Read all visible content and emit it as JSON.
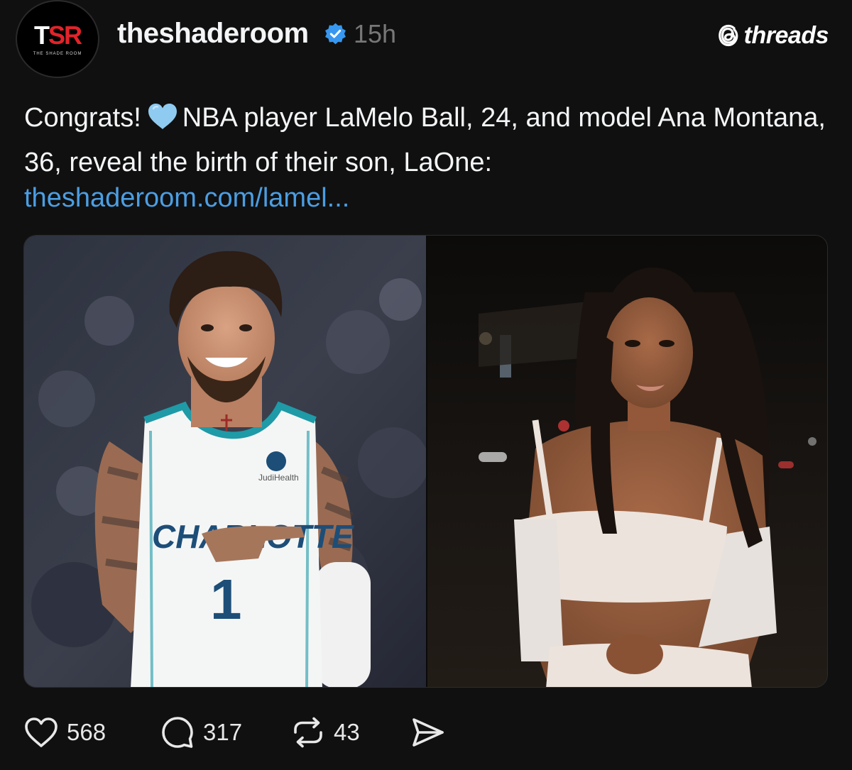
{
  "post": {
    "avatar": {
      "logo_left": "T",
      "logo_mid": "S",
      "logo_right": "R",
      "logo_sub": "THE SHADE ROOM",
      "icon": "tsr-logo"
    },
    "username": "theshaderoom",
    "verified_icon": "verified-badge-icon",
    "timestamp": "15h",
    "brand": "threads",
    "brand_icon": "threads-logo-icon",
    "text_before_emoji": "Congrats!",
    "emoji": "light-blue-heart",
    "text_after_emoji": "NBA player LaMelo Ball, 24, and model Ana Montana, 36, reveal the birth of their son, LaOne:",
    "link": "theshaderoom.com/lamel...",
    "media": {
      "left_photo": "smiling basketball player in white Charlotte jersey number 1",
      "right_photo": "smiling woman in white crop top at night"
    },
    "actions": {
      "likes": "568",
      "replies": "317",
      "reposts": "43"
    }
  },
  "colors": {
    "background": "#101010",
    "text": "#f3f5f7",
    "muted": "#777777",
    "link": "#4b9ee3",
    "verified": "#3797f0",
    "tsr_red": "#e2232a"
  }
}
